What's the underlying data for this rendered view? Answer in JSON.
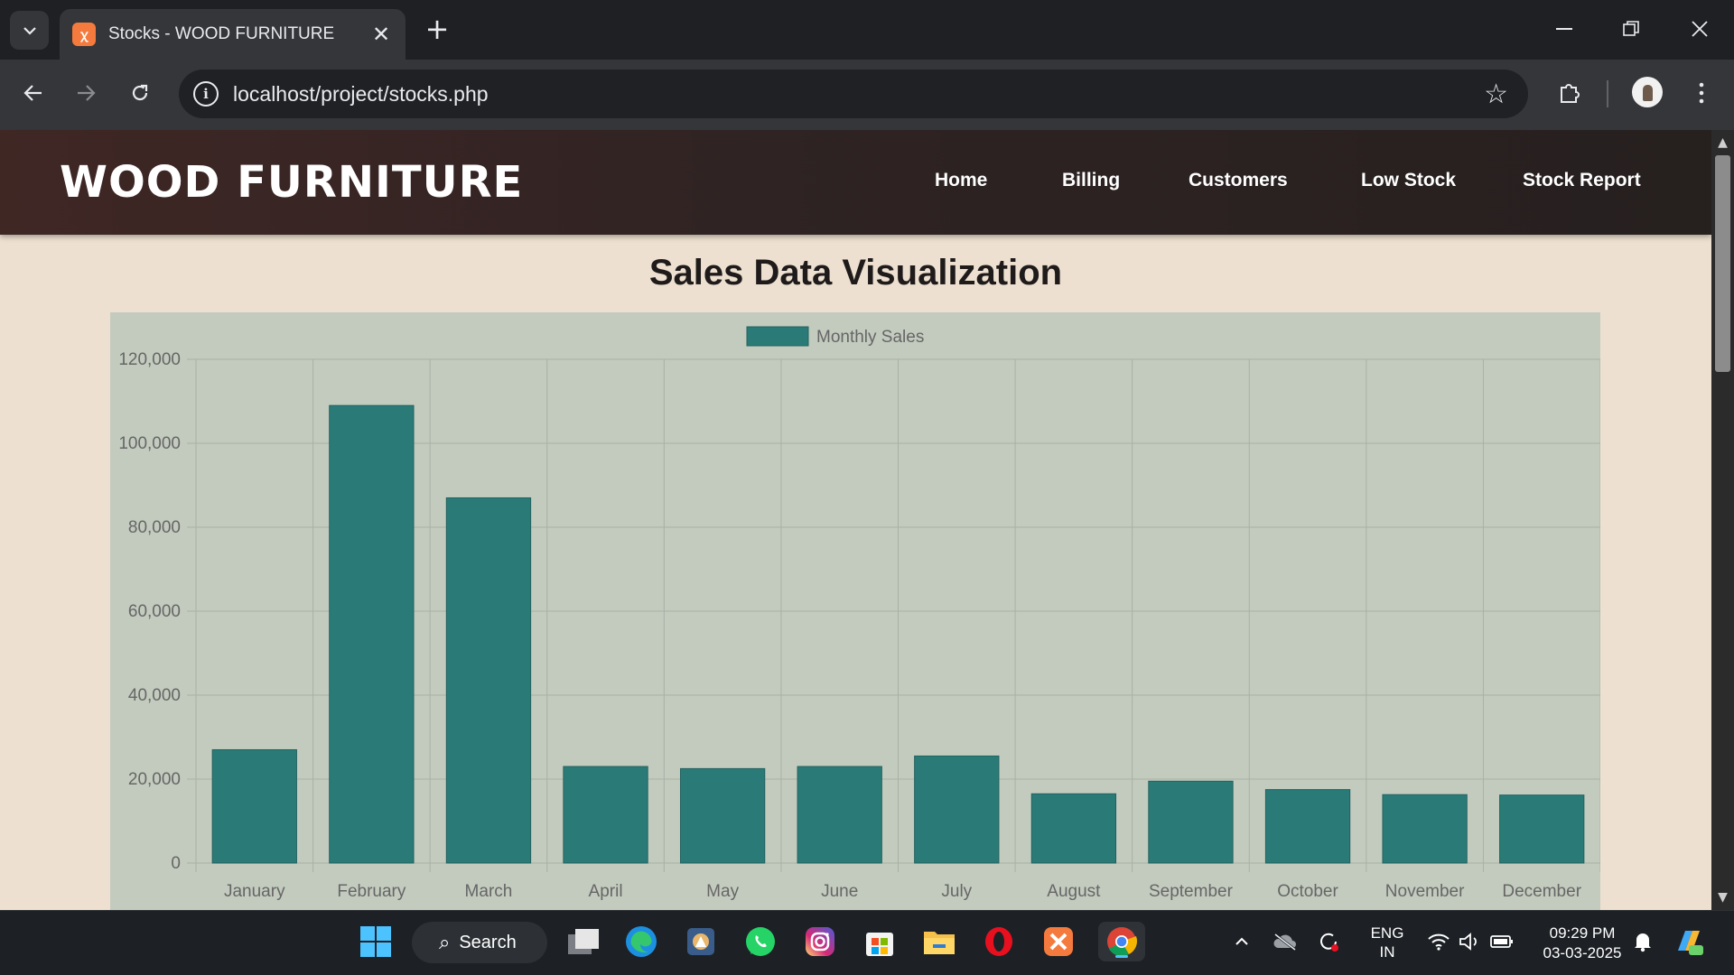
{
  "browser": {
    "tab_title": "Stocks - WOOD FURNITURE",
    "url": "localhost/project/stocks.php"
  },
  "site": {
    "brand": "WOOD FURNITURE",
    "nav": [
      "Home",
      "Billing",
      "Customers",
      "Low Stock",
      "Stock Report"
    ],
    "page_title": "Sales Data Visualization"
  },
  "chart_data": {
    "type": "bar",
    "title": "",
    "xlabel": "",
    "ylabel": "",
    "legend_position": "top-center",
    "grid": true,
    "ylim": [
      0,
      120000
    ],
    "y_ticks": [
      0,
      20000,
      40000,
      60000,
      80000,
      100000,
      120000
    ],
    "y_tick_labels": [
      "0",
      "20,000",
      "40,000",
      "60,000",
      "80,000",
      "100,000",
      "120,000"
    ],
    "categories": [
      "January",
      "February",
      "March",
      "April",
      "May",
      "June",
      "July",
      "August",
      "September",
      "October",
      "November",
      "December"
    ],
    "series": [
      {
        "name": "Monthly Sales",
        "color": "#2a7b78",
        "values": [
          27000,
          109000,
          87000,
          23000,
          22500,
          23000,
          25500,
          16500,
          19500,
          17500,
          16300,
          16200
        ]
      }
    ]
  },
  "taskbar": {
    "search_label": "Search",
    "lang_primary": "ENG",
    "lang_secondary": "IN",
    "time": "09:29 PM",
    "date": "03-03-2025"
  }
}
